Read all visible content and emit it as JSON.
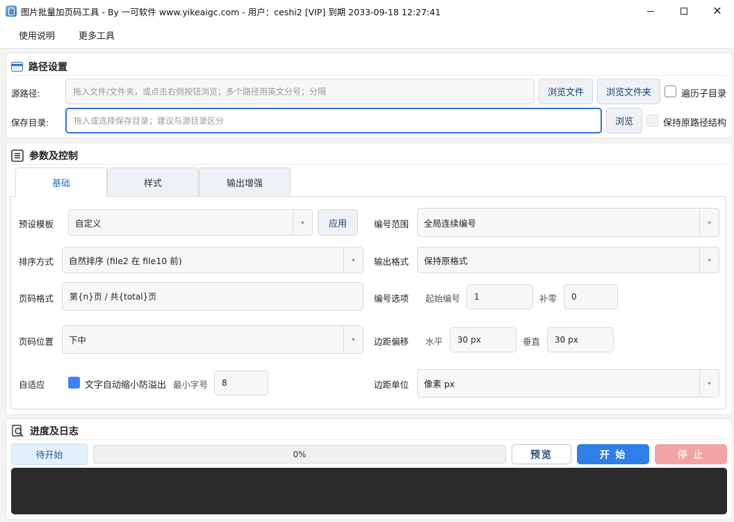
{
  "window": {
    "title": "图片批量加页码工具 - By 一可软件 www.yikeaigc.com  -  用户：ceshi2 [VIP] 到期 2033-09-18 12:27:41",
    "close_glyph": "✕"
  },
  "menu": {
    "items": [
      "使用说明",
      "更多工具"
    ]
  },
  "path_section": {
    "title": "路径设置",
    "source_label": "源路径:",
    "source_placeholder": "拖入文件/文件夹，或点击右侧按钮浏览；多个路径用英文分号；分隔",
    "browse_file": "浏览文件",
    "browse_folder": "浏览文件夹",
    "recurse_label": "遍历子目录",
    "save_label": "保存目录:",
    "save_placeholder": "拖入或选择保存目录；建议与源目录区分",
    "browse": "浏览",
    "keep_structure_label": "保持原路径结构"
  },
  "params_section": {
    "title": "参数及控制",
    "tabs": [
      "基础",
      "样式",
      "输出增强"
    ],
    "preset_label": "预设模板",
    "preset_value": "自定义",
    "apply_button": "应用",
    "sort_label": "排序方式",
    "sort_value": "自然排序 (file2 在 file10 前)",
    "format_label": "页码格式",
    "format_value": "第{n}页 / 共{total}页",
    "position_label": "页码位置",
    "position_value": "下中",
    "adaptive_label": "自适应",
    "adaptive_check_label": "文字自动缩小防溢出",
    "min_font_label": "最小字号",
    "min_font_value": "8",
    "range_label": "编号范围",
    "range_value": "全局连续编号",
    "output_format_label": "输出格式",
    "output_format_value": "保持原格式",
    "number_options_label": "编号选项",
    "start_label": "起始编号",
    "start_value": "1",
    "pad_label": "补零",
    "pad_value": "0",
    "margin_label": "边距偏移",
    "horizontal_label": "水平",
    "horizontal_value": "30 px",
    "vertical_label": "垂直",
    "vertical_value": "30 px",
    "unit_label": "边距单位",
    "unit_value": "像素 px",
    "dropdown_glyph": "▾"
  },
  "progress_section": {
    "title": "进度及日志",
    "status": "待开始",
    "percent_text": "0%",
    "percent": 0,
    "preview_button": "预览",
    "start_button": "开 始",
    "stop_button": "停 止"
  },
  "colors": {
    "accent": "#2f7fe8",
    "stop_disabled": "#f2a3a3",
    "log_background": "#2b2b2b"
  }
}
